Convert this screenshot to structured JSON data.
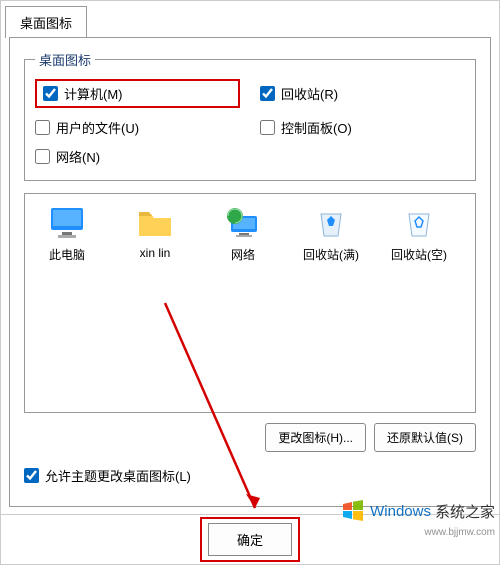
{
  "tab": {
    "label": "桌面图标"
  },
  "group": {
    "legend": "桌面图标",
    "items": [
      {
        "key": "computer",
        "label": "计算机(M)",
        "checked": true,
        "highlighted": true
      },
      {
        "key": "recycle",
        "label": "回收站(R)",
        "checked": true,
        "highlighted": false
      },
      {
        "key": "userfiles",
        "label": "用户的文件(U)",
        "checked": false,
        "highlighted": false
      },
      {
        "key": "controlpanel",
        "label": "控制面板(O)",
        "checked": false,
        "highlighted": false
      },
      {
        "key": "network",
        "label": "网络(N)",
        "checked": false,
        "highlighted": false
      }
    ]
  },
  "preview_icons": [
    {
      "key": "thispc",
      "label": "此电脑"
    },
    {
      "key": "userfolder",
      "label": "xin lin"
    },
    {
      "key": "network",
      "label": "网络"
    },
    {
      "key": "recycle_full",
      "label": "回收站(满)"
    },
    {
      "key": "recycle_empty",
      "label": "回收站(空)"
    }
  ],
  "buttons": {
    "change_icon": "更改图标(H)...",
    "restore_default": "还原默认值(S)",
    "ok": "确定"
  },
  "allow_theme": {
    "label": "允许主题更改桌面图标(L)",
    "checked": true
  },
  "watermark": {
    "brand": "Windows",
    "suffix": "系统之家",
    "url": "www.bjjmw.com"
  }
}
